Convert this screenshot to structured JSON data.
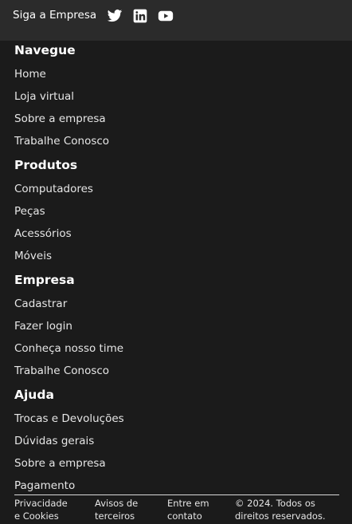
{
  "social": {
    "label": "Siga a Empresa",
    "links": [
      {
        "icon": "twitter-icon"
      },
      {
        "icon": "linkedin-icon"
      },
      {
        "icon": "youtube-icon"
      }
    ]
  },
  "sections": [
    {
      "title": "Navegue",
      "links": [
        "Home",
        "Loja virtual",
        "Sobre a empresa",
        "Trabalhe Conosco"
      ]
    },
    {
      "title": "Produtos",
      "links": [
        "Computadores",
        "Peças",
        "Acessórios",
        "Móveis"
      ]
    },
    {
      "title": "Empresa",
      "links": [
        "Cadastrar",
        "Fazer login",
        "Conheça nosso time",
        "Trabalhe Conosco"
      ]
    },
    {
      "title": "Ajuda",
      "links": [
        "Trocas e Devoluções",
        "Dúvidas gerais",
        "Sobre a empresa",
        "Pagamento"
      ]
    }
  ],
  "footer": {
    "privacy_l1": "Privacidade",
    "privacy_l2": "e Cookies",
    "third_l1": "Avisos de",
    "third_l2": "terceiros",
    "contact_l1": "Entre em",
    "contact_l2": "contato",
    "copyright_l1": "© 2024. Todos os",
    "copyright_l2": "direitos reservados."
  },
  "colors": {
    "background": "#1b1b1b",
    "topbar": "#2b2b2b",
    "text": "#ffffff"
  }
}
